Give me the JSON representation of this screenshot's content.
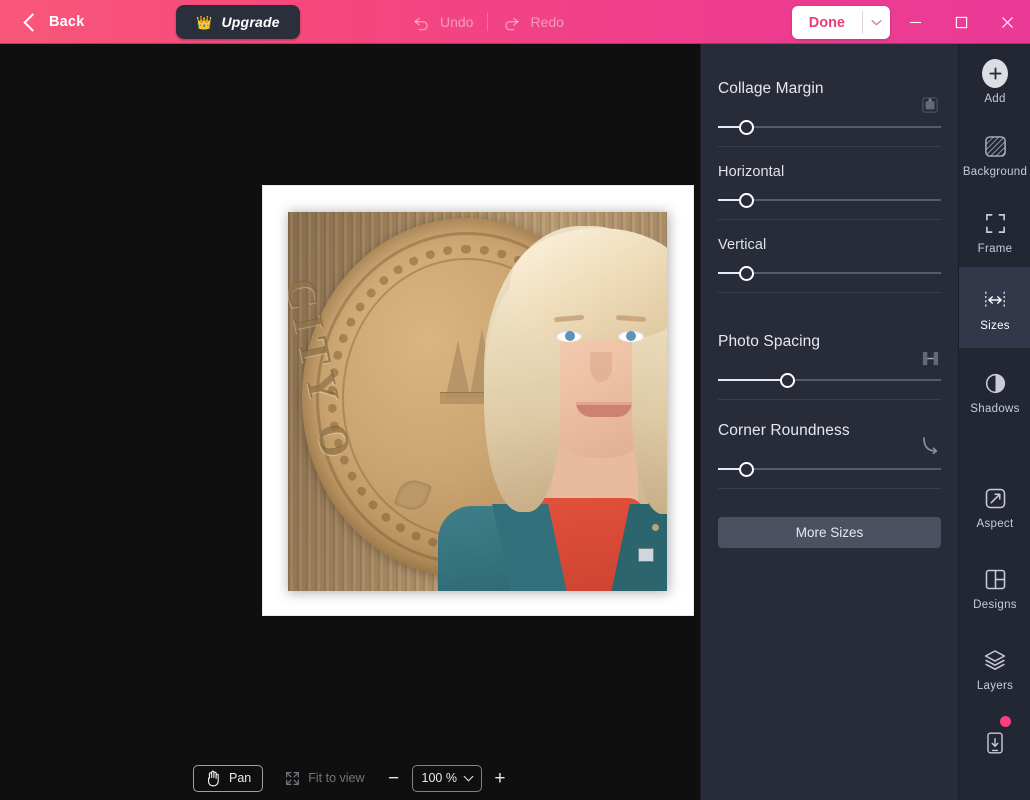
{
  "topbar": {
    "back_label": "Back",
    "upgrade_label": "Upgrade",
    "crown_icon": "crown-icon",
    "undo_label": "Undo",
    "redo_label": "Redo",
    "done_label": "Done",
    "minimize_icon": "minimize-icon",
    "maximize_icon": "maximize-icon",
    "close_icon": "close-icon",
    "accent_pink": "#ee3d8e",
    "done_text_color": "#ea3a78"
  },
  "panel": {
    "background_color": "#282c38",
    "sections": [
      {
        "title": "Collage Margin",
        "icon": "margin-icon",
        "slider_percent": 13,
        "has_rule": true
      },
      {
        "title": "Horizontal",
        "icon": "",
        "slider_percent": 13,
        "has_rule": true
      },
      {
        "title": "Vertical",
        "icon": "",
        "slider_percent": 13,
        "has_rule": true
      },
      {
        "title": "Photo Spacing",
        "icon": "spacing-icon",
        "slider_percent": 31,
        "has_rule": true
      },
      {
        "title": "Corner Roundness",
        "icon": "corner-roundness-icon",
        "slider_percent": 13,
        "has_rule": true
      }
    ],
    "more_sizes_label": "More Sizes"
  },
  "rail": {
    "background_color": "#232734",
    "active_color": "#32374a",
    "badge_color": "#ff3d7f",
    "items": [
      {
        "label": "Add",
        "icon": "plus-circle-icon",
        "active": false
      },
      {
        "label": "Background",
        "icon": "hatched-square-icon",
        "active": false
      },
      {
        "label": "Frame",
        "icon": "frame-corners-icon",
        "active": false
      },
      {
        "label": "Sizes",
        "icon": "width-arrows-icon",
        "active": true
      },
      {
        "label": "Shadows",
        "icon": "half-circle-icon",
        "active": false
      },
      {
        "label": "Aspect",
        "icon": "diagonal-arrow-square-icon",
        "active": false
      },
      {
        "label": "Designs",
        "icon": "layout-grid-icon",
        "active": false
      },
      {
        "label": "Layers",
        "icon": "stacked-layers-icon",
        "active": false
      },
      {
        "label": "",
        "icon": "mobile-download-icon",
        "active": false
      }
    ]
  },
  "bottombar": {
    "pan_label": "Pan",
    "pan_icon": "hand-icon",
    "fit_label": "Fit to view",
    "fit_icon": "fit-arrows-icon",
    "zoom_out_label": "−",
    "zoom_in_label": "+",
    "zoom_value": "100 %"
  },
  "canvas": {
    "background_color": "#0f0f0f",
    "sheet_color": "#ffffff",
    "photo_alt": "Woman with blonde hair in teal blazer and red shirt in front of a bronze city seal on wood paneling",
    "seal_text": "CITY O"
  }
}
